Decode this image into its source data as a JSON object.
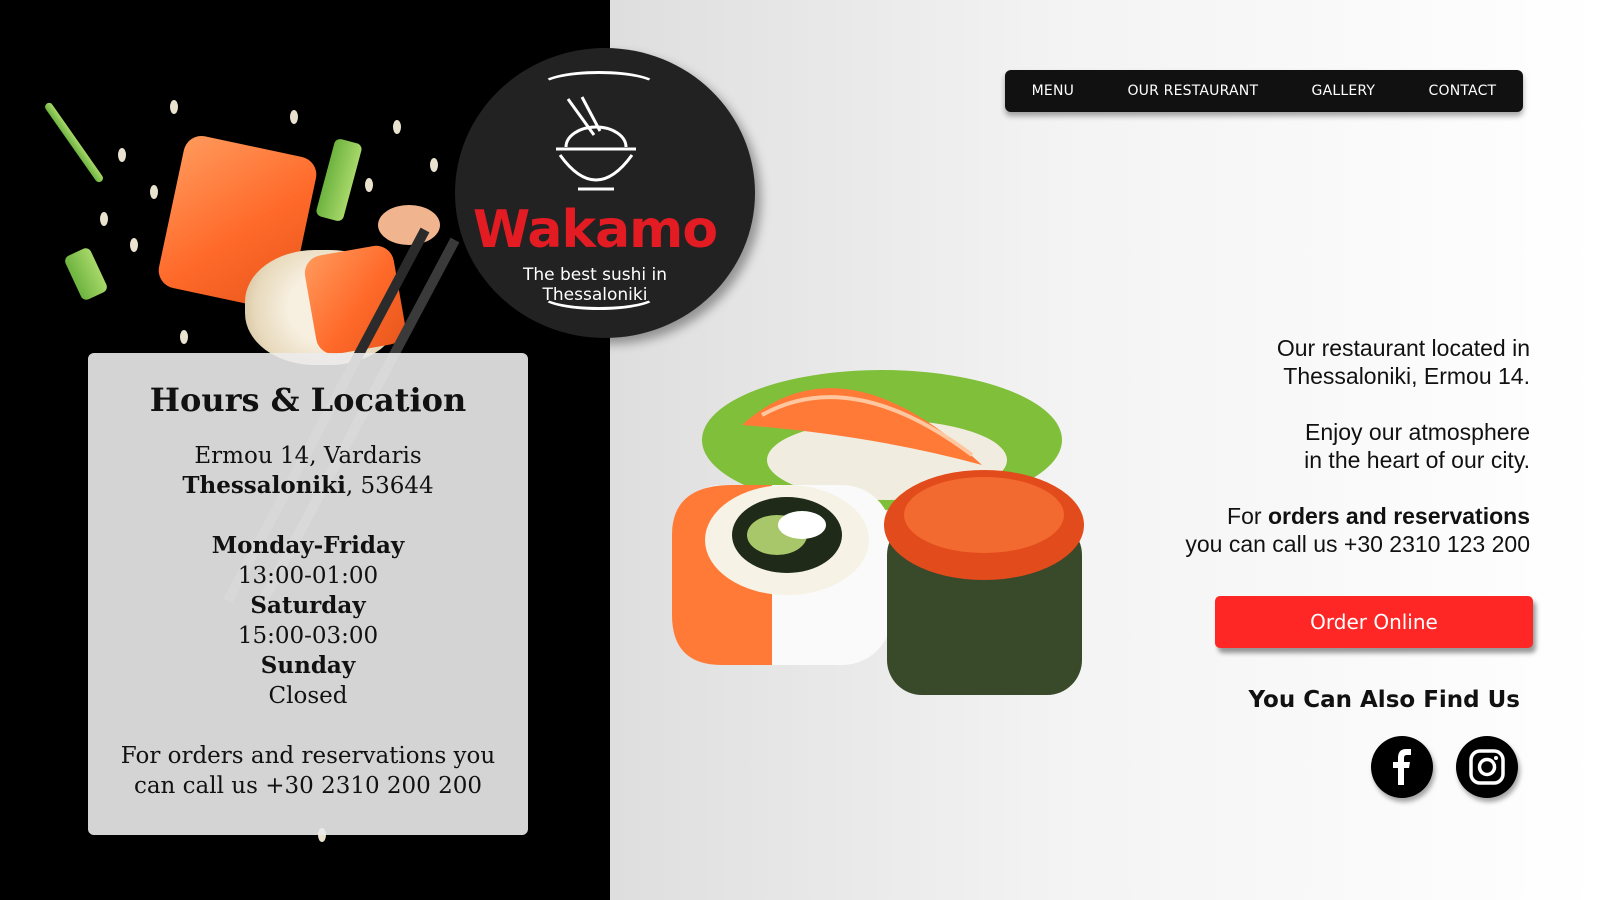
{
  "logo": {
    "brand": "Wakamo",
    "tagline": "The best sushi in Thessaloniki",
    "brand_color": "#e31b23"
  },
  "nav": {
    "items": [
      {
        "label": "MENU"
      },
      {
        "label": "OUR RESTAURANT"
      },
      {
        "label": "GALLERY"
      },
      {
        "label": "CONTACT"
      }
    ]
  },
  "hours": {
    "title": "Hours & Location",
    "address_line1": "Ermou 14, Vardaris",
    "city": "Thessaloniki",
    "postal": ", 53644",
    "schedule": [
      {
        "day": "Monday-Friday",
        "time": "13:00-01:00"
      },
      {
        "day": "Saturday",
        "time": "15:00-03:00"
      },
      {
        "day": "Sunday",
        "time": "Closed"
      }
    ],
    "contact_line1": "For orders and reservations you",
    "contact_line2": "can call us +30 2310 200 200"
  },
  "info": {
    "location_line1": "Our restaurant located in",
    "location_line2": "Thessaloniki, Ermou 14.",
    "atmosphere_line1": "Enjoy our atmosphere",
    "atmosphere_line2": "in the heart of our city.",
    "orders_prefix": "For ",
    "orders_bold": "orders and reservations",
    "orders_line2": "you can call us +30 2310 123 200"
  },
  "order_button": {
    "label": "Order Online",
    "color": "#ff2626"
  },
  "find_us": {
    "label": "You Can Also Find Us"
  },
  "social": {
    "facebook_icon": "facebook-icon",
    "instagram_icon": "instagram-icon"
  }
}
